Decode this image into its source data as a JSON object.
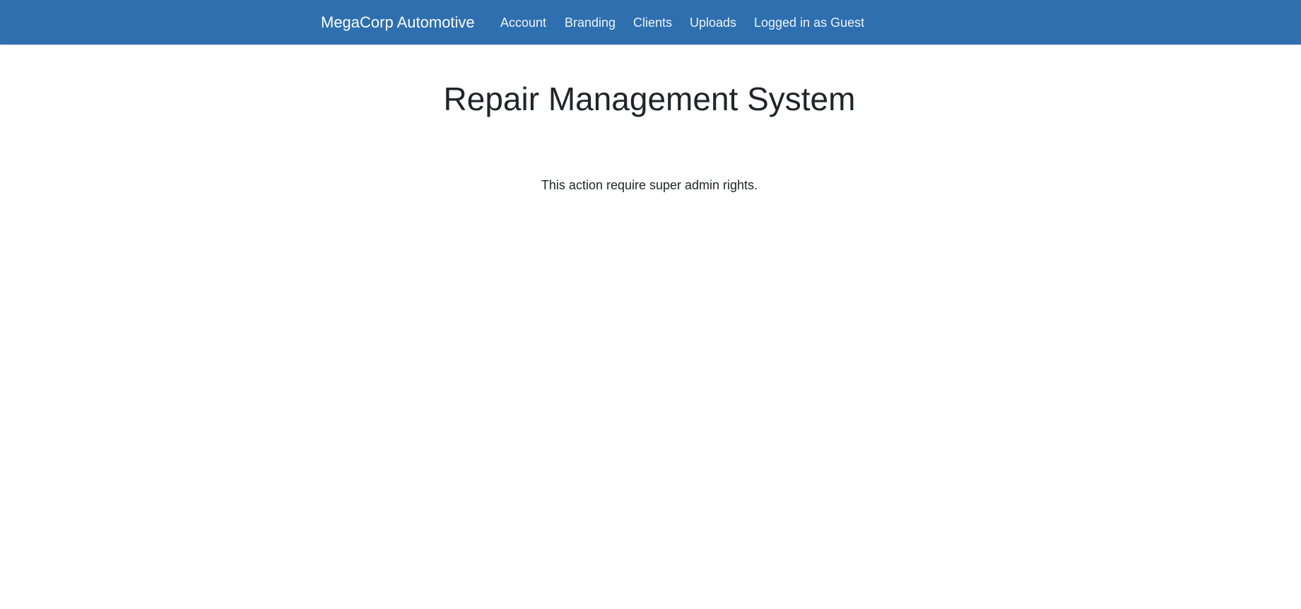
{
  "colors": {
    "navbar_background": "#2e6fb0",
    "navbar_text": "#ffffff",
    "page_background": "#ffffff",
    "body_text": "#212529"
  },
  "navbar": {
    "brand": "MegaCorp Automotive",
    "items": [
      {
        "label": "Account"
      },
      {
        "label": "Branding"
      },
      {
        "label": "Clients"
      },
      {
        "label": "Uploads"
      }
    ],
    "user_status": "Logged in as Guest"
  },
  "main": {
    "title": "Repair Management System",
    "message": "This action require super admin rights."
  }
}
